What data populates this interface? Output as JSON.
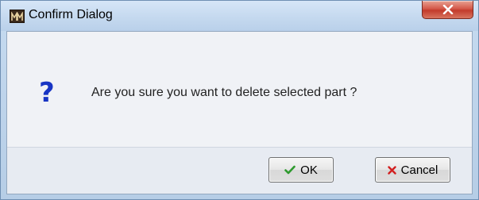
{
  "window": {
    "title": "Confirm Dialog"
  },
  "dialog": {
    "icon": "question-icon",
    "icon_glyph": "?",
    "message": "Are you sure you want to delete selected part ?",
    "ok_label": "OK",
    "cancel_label": "Cancel"
  },
  "colors": {
    "question_icon": "#1835c4",
    "ok_check": "#2e9a2e",
    "cancel_x": "#d21f1f",
    "close_button": "#c23b2b"
  }
}
